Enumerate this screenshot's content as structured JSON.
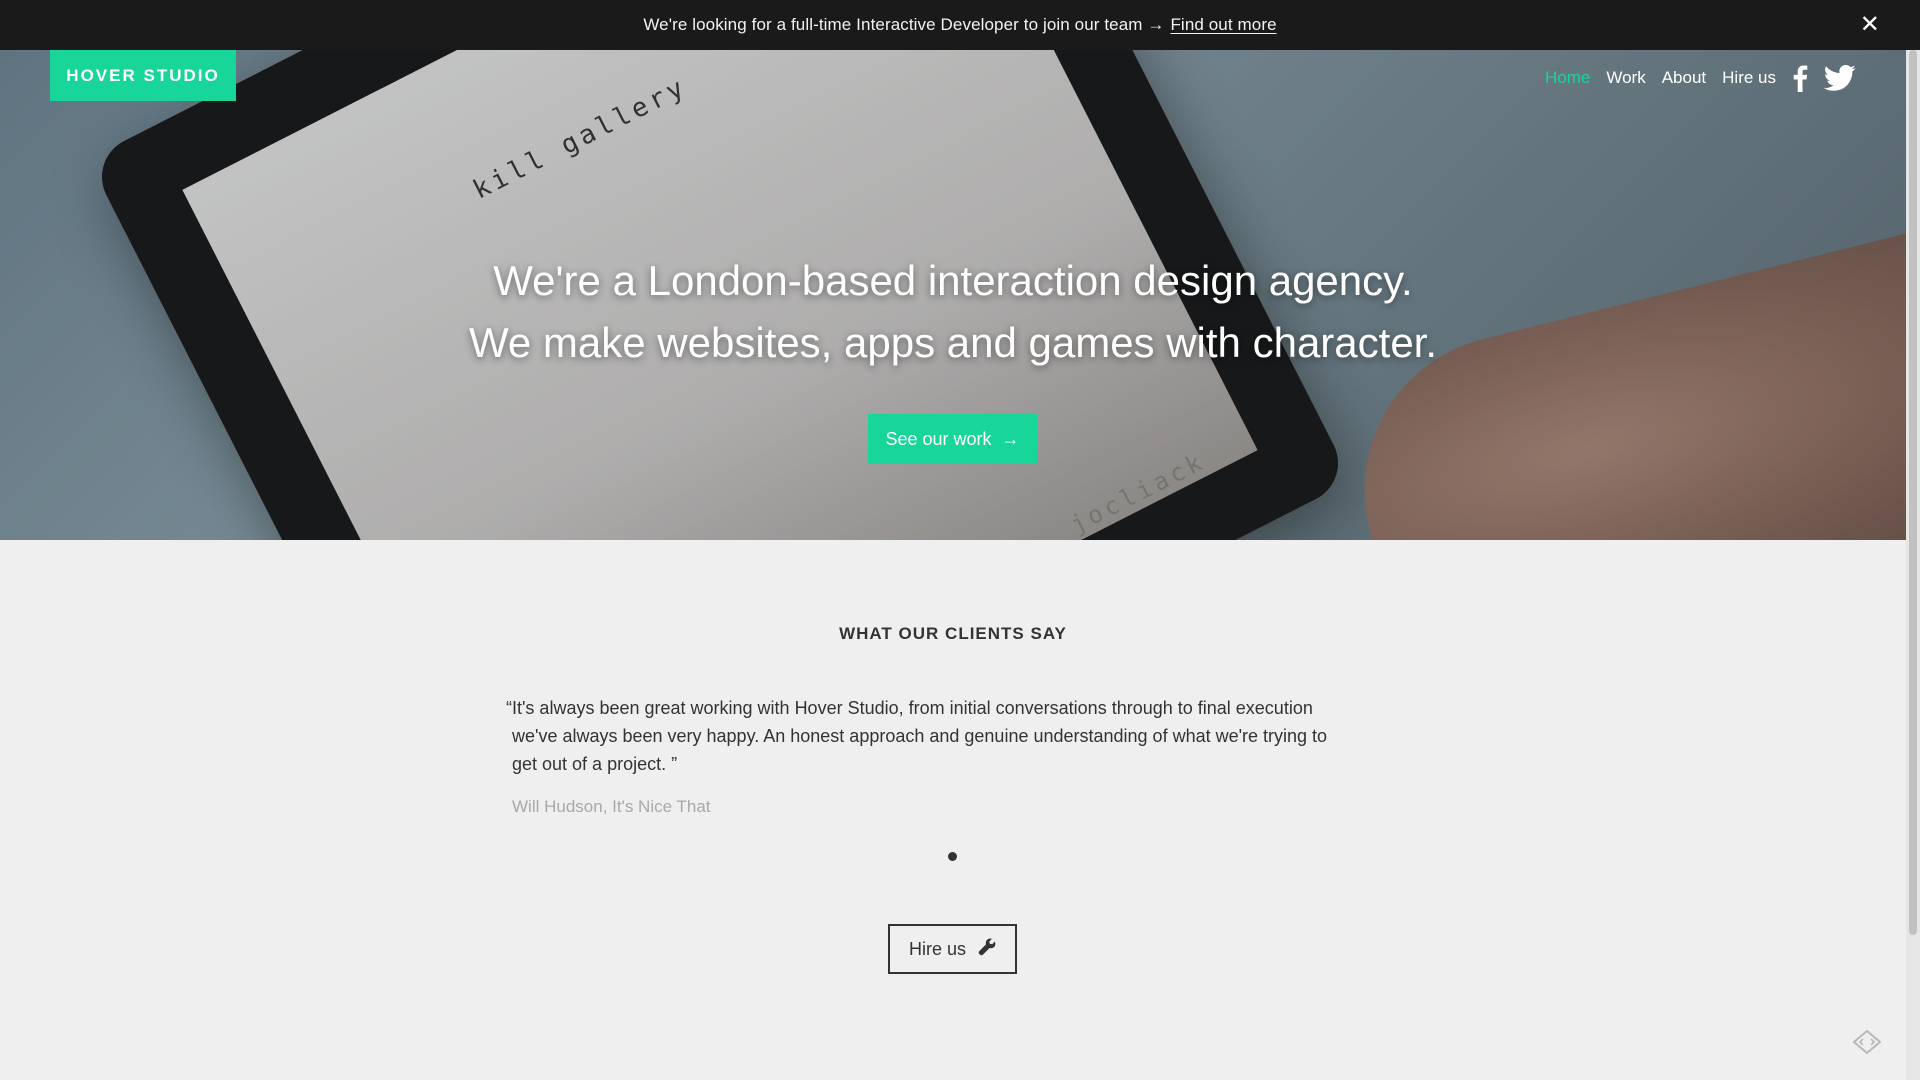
{
  "announcement": {
    "message": "We're looking for a full-time Interactive Developer to join our team →",
    "link_label": "Find out more",
    "close_glyph": "✕"
  },
  "header": {
    "logo": "HOVER STUDIO",
    "nav": [
      {
        "label": "Home",
        "active": true
      },
      {
        "label": "Work",
        "active": false
      },
      {
        "label": "About",
        "active": false
      },
      {
        "label": "Hire us",
        "active": false
      }
    ],
    "social_icons": [
      "facebook-icon",
      "twitter-icon"
    ]
  },
  "hero": {
    "headline_line1": "We're a London-based interaction design agency.",
    "headline_line2": "We make websites, apps and games with character.",
    "cta_label": "See our work",
    "cta_arrow": "→",
    "screen_text_top": "kill gallery",
    "screen_text_bottom": "jocliack"
  },
  "testimonials": {
    "title": "WHAT OUR CLIENTS SAY",
    "quote": "“It's always been great working with Hover Studio, from initial conversations through to final execution we've always been very happy. An honest approach and genuine understanding of what we're trying to get out of a project. ”",
    "author": "Will Hudson, It's Nice That",
    "pager_count": 1
  },
  "hire_button": {
    "label": "Hire us",
    "icon": "wrench-icon"
  },
  "colors": {
    "brand_green": "#18d59a",
    "dark": "#1a1a1a",
    "page_bg": "#efefef"
  }
}
